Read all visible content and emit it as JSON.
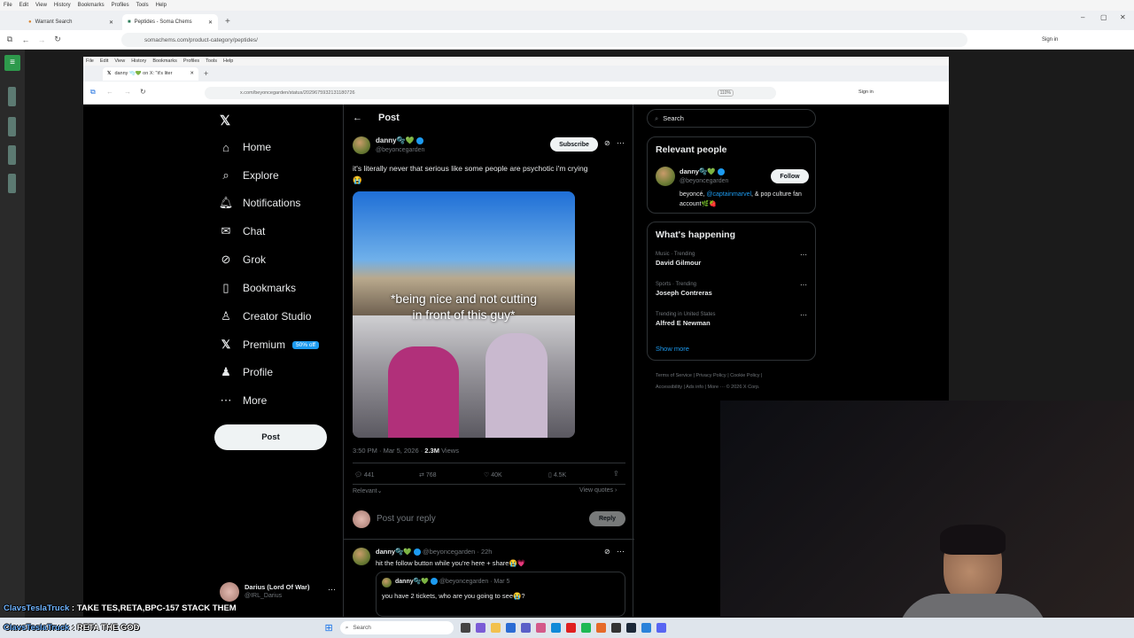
{
  "outer_browser": {
    "menu": [
      "File",
      "Edit",
      "View",
      "History",
      "Bookmarks",
      "Profiles",
      "Tools",
      "Help"
    ],
    "tabs": [
      "Warrant Search",
      "Peptides - Soma Chems"
    ],
    "url": "somachems.com/product-category/peptides/",
    "signin": "Sign in"
  },
  "inner_browser": {
    "menu": [
      "File",
      "Edit",
      "View",
      "History",
      "Bookmarks",
      "Profiles",
      "Tools",
      "Help"
    ],
    "tab_title": "danny 🫧💚 on X: \"it's liter",
    "url": "x.com/beyoncegarden/status/2029675932131180726",
    "zoom": "110%",
    "signin": "Sign in"
  },
  "x_nav": {
    "items": [
      "Home",
      "Explore",
      "Notifications",
      "Chat",
      "Grok",
      "Bookmarks",
      "Creator Studio",
      "Premium",
      "Profile",
      "More"
    ],
    "premium_badge": "50% off",
    "post_button": "Post",
    "account_name": "Darius (Lord Of War)",
    "account_handle": "@IRL_Darius"
  },
  "post": {
    "header": "Post",
    "author_name": "danny🫧💚",
    "author_handle": "@beyoncegarden",
    "subscribe": "Subscribe",
    "text": "it's literally never that serious like some people are psychotic i'm crying",
    "emoji": "😭",
    "caption_line1": "*being nice and not cutting",
    "caption_line2": "in front of this guy*",
    "time": "3:50 PM · Mar 5, 2026 · ",
    "views_count": "2.3M",
    "views_label": " Views",
    "replies": "441",
    "reposts": "768",
    "likes": "40K",
    "bookmarks": "4.5K",
    "relevant": "Relevant",
    "view_quotes": "View quotes",
    "reply_placeholder": "Post your reply",
    "reply_button": "Reply"
  },
  "reply": {
    "name": "danny🫧💚",
    "handle_time": "@beyoncegarden · 22h",
    "text": "hit the follow button while you're here + share😭💗",
    "quote_name": "danny🫧💚",
    "quote_handle_time": "@beyoncegarden · Mar 5",
    "quote_text": "you have 2 tickets, who are you going to see😭?"
  },
  "right": {
    "search_placeholder": "Search",
    "relevant_title": "Relevant people",
    "person_name": "danny🫧💚",
    "person_handle": "@beyoncegarden",
    "follow": "Follow",
    "bio_pre": "beyoncé, ",
    "bio_link": "@captainmarvel",
    "bio_post": ", & pop culture fan account🌿🍓",
    "happening_title": "What's happening",
    "trends": [
      {
        "cat": "Music · Trending",
        "name": "David Gilmour"
      },
      {
        "cat": "Sports · Trending",
        "name": "Joseph Contreras"
      },
      {
        "cat": "Trending in United States",
        "name": "Alfred E Newman"
      }
    ],
    "show_more": "Show more",
    "footer_line1": "Terms of Service  |  Privacy Policy  |  Cookie Policy  |",
    "footer_line2": "Accessibility  |  Ads info  |  More ···  © 2026 X Corp."
  },
  "chat": [
    {
      "user": "ClavsTeslaTruck",
      "msg": " : TAKE TES,RETA,BPC-157 STACK THEM"
    },
    {
      "user": "ClavsTeslaTruck",
      "msg": " : RETA THE GOD"
    }
  ],
  "taskbar": {
    "search": "Search"
  },
  "colors": {
    "accent": "#1d9bf0",
    "background": "#000000",
    "premium": "#1d9bf0"
  }
}
